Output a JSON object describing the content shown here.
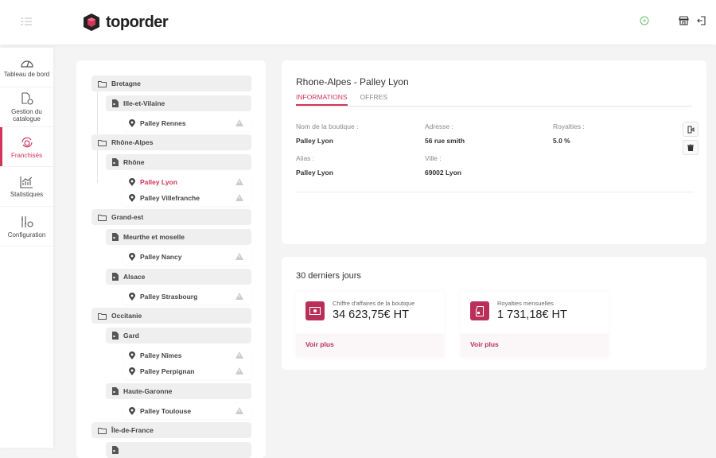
{
  "app": {
    "brand": "toporder"
  },
  "colors": {
    "accent": "#d0365a",
    "icon_bg": "#b8305a"
  },
  "sidebar": {
    "items": [
      {
        "label": "Tableau de bord",
        "icon": "gauge-icon"
      },
      {
        "label": "Gestion du catalogue",
        "icon": "catalog-gear-icon"
      },
      {
        "label": "Franchisés",
        "icon": "franchise-icon",
        "active": true
      },
      {
        "label": "Statistiques",
        "icon": "chart-icon"
      },
      {
        "label": "Configuration",
        "icon": "settings-icon"
      }
    ]
  },
  "tree": [
    {
      "type": "region",
      "label": "Bretagne"
    },
    {
      "type": "dept",
      "label": "Ille-et-Vilaine"
    },
    {
      "type": "store",
      "label": "Palley Rennes"
    },
    {
      "type": "region",
      "label": "Rhône-Alpes"
    },
    {
      "type": "dept",
      "label": "Rhône"
    },
    {
      "type": "store",
      "label": "Palley Lyon",
      "active": true
    },
    {
      "type": "store",
      "label": "Palley Villefranche"
    },
    {
      "type": "region",
      "label": "Grand-est"
    },
    {
      "type": "dept",
      "label": "Meurthe et moselle"
    },
    {
      "type": "store",
      "label": "Palley Nancy"
    },
    {
      "type": "dept",
      "label": "Alsace"
    },
    {
      "type": "store",
      "label": "Palley Strasbourg"
    },
    {
      "type": "region",
      "label": "Occitanie"
    },
    {
      "type": "dept",
      "label": "Gard"
    },
    {
      "type": "store",
      "label": "Palley Nîmes"
    },
    {
      "type": "store",
      "label": "Palley Perpignan"
    },
    {
      "type": "dept",
      "label": "Haute-Garonne"
    },
    {
      "type": "store",
      "label": "Palley Toulouse"
    },
    {
      "type": "region",
      "label": "Île-de-France"
    },
    {
      "type": "dept",
      "label": ""
    }
  ],
  "detail": {
    "title": "Rhone-Alpes - Palley Lyon",
    "tabs": [
      "INFORMATIONS",
      "OFFRES"
    ],
    "fields": {
      "name_label": "Nom de la boutique :",
      "name": "Palley Lyon",
      "address_label": "Adresse :",
      "address": "56 rue smith",
      "royalties_label": "Royalties :",
      "royalties": "5.0 %",
      "alias_label": "Alias :",
      "alias": "Palley Lyon",
      "city_label": "Ville :",
      "city": "69002 Lyon"
    }
  },
  "stats": {
    "title": "30 derniers jours",
    "kpis": [
      {
        "label": "Chiffre d'affaires de la boutique",
        "value": "34 623,75€ HT",
        "link": "Voir plus"
      },
      {
        "label": "Royalties mensuelles",
        "value": "1 731,18€ HT",
        "link": "Voir plus"
      }
    ]
  }
}
